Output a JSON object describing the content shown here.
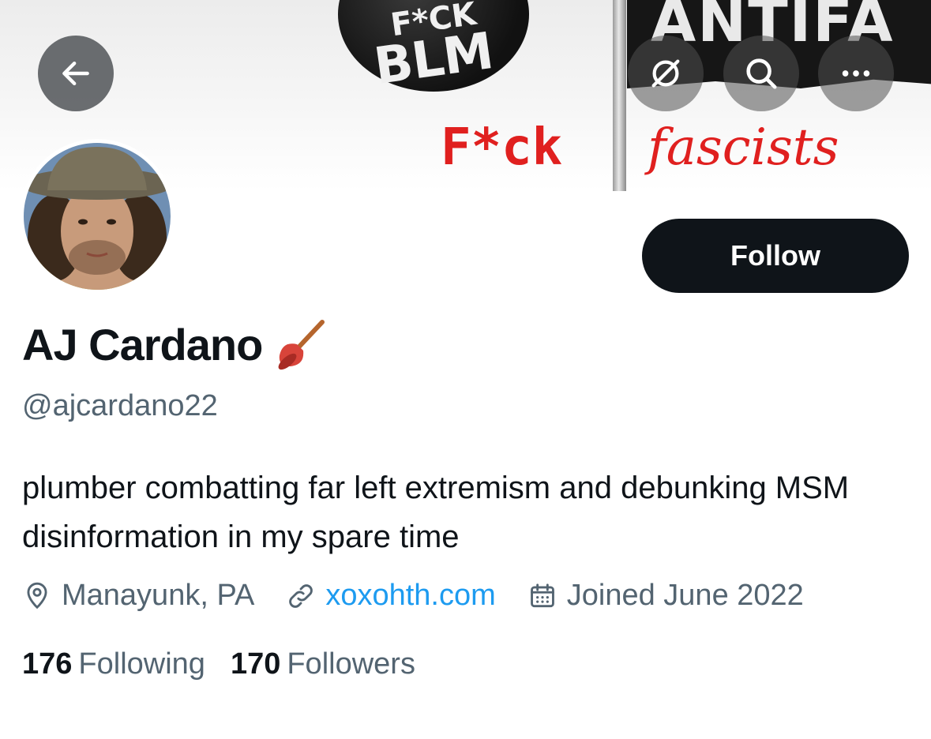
{
  "banner": {
    "badge_top": "F*CK",
    "badge_main": "BLM",
    "flag_text": "ANTIFA",
    "slogan_left": "F*ck",
    "slogan_right": "fascists"
  },
  "header": {
    "back_icon": "arrow-left-icon",
    "actions": [
      {
        "icon": "grok-icon"
      },
      {
        "icon": "search-icon"
      },
      {
        "icon": "more-icon"
      }
    ]
  },
  "profile": {
    "name": "AJ Cardano",
    "name_emoji": "🪠",
    "handle": "@ajcardano22",
    "follow_label": "Follow",
    "bio": "plumber combatting far left extremism and debunking MSM disinformation in my spare time",
    "location": "Manayunk, PA",
    "website": "xoxohth.com",
    "joined": "Joined June 2022",
    "following_count": "176",
    "following_label": "Following",
    "followers_count": "170",
    "followers_label": "Followers"
  },
  "colors": {
    "text": "#0f1419",
    "secondary": "#536471",
    "link": "#1d9bf0",
    "button": "#0f1419"
  }
}
